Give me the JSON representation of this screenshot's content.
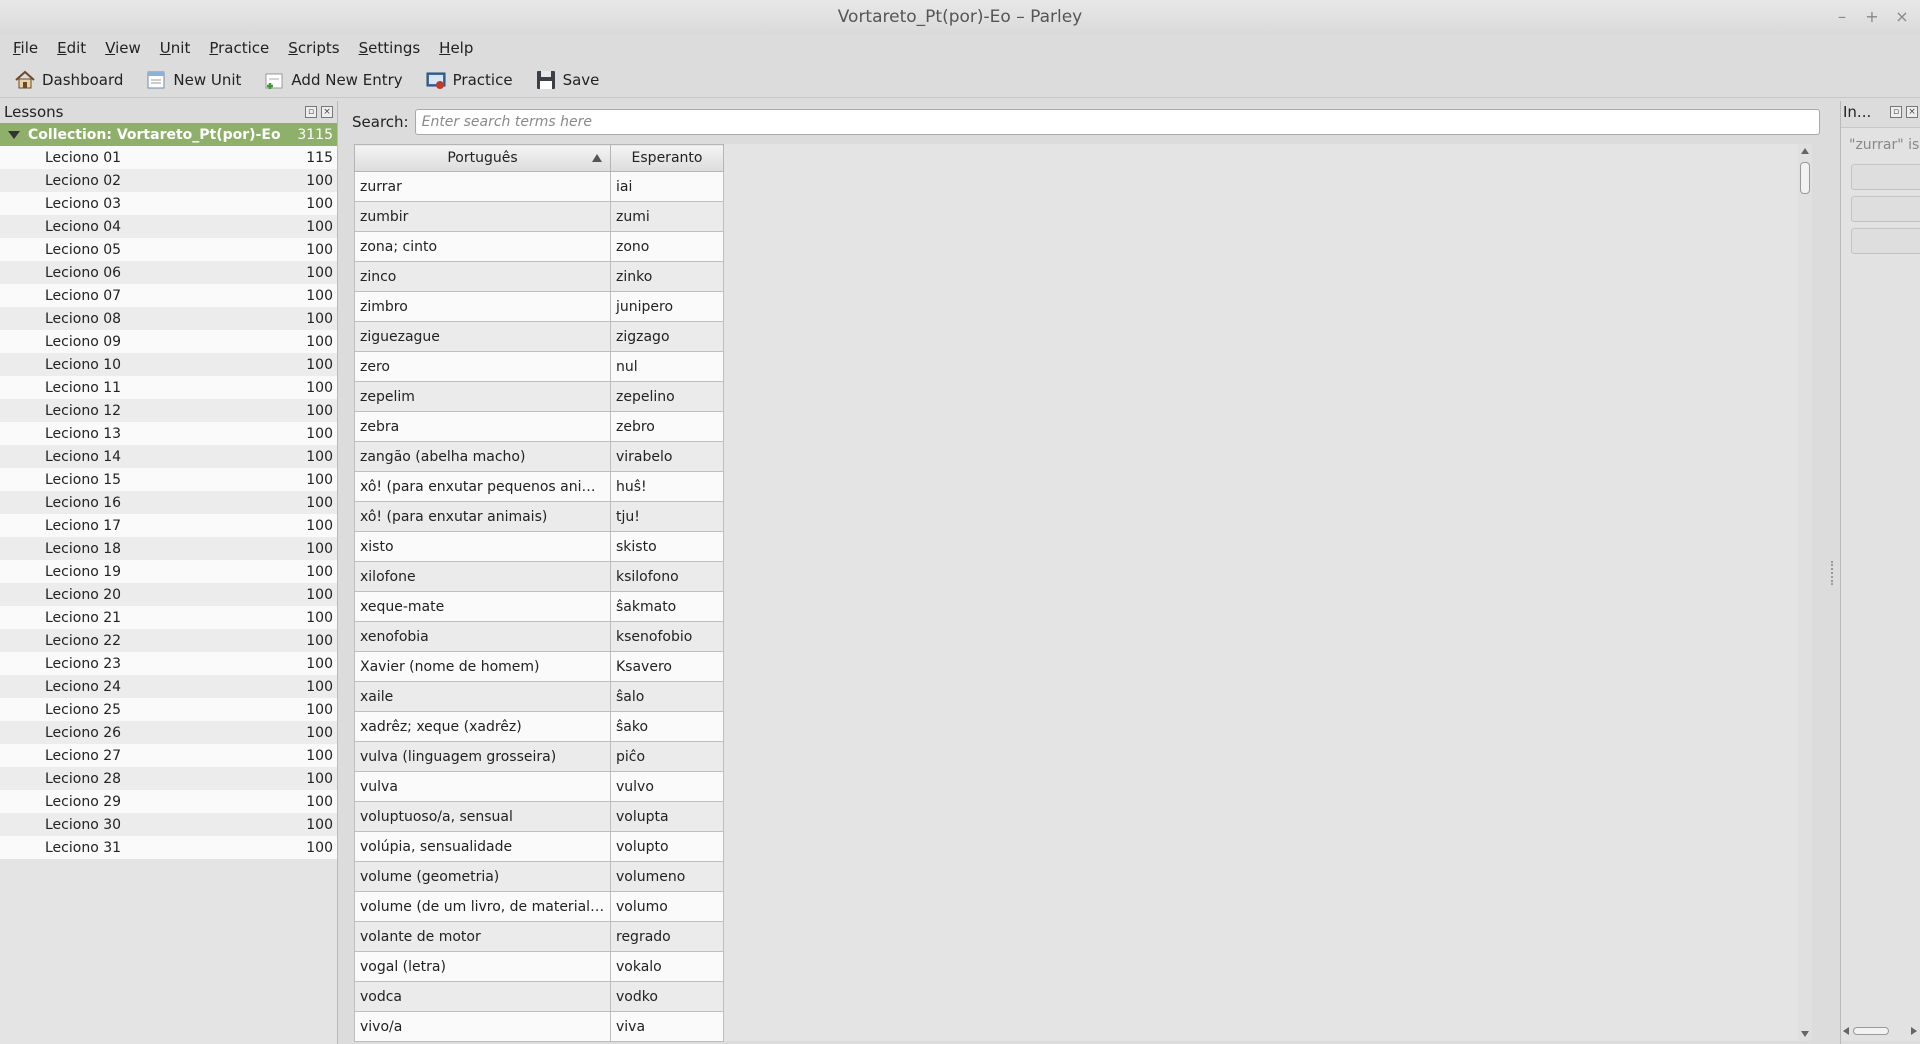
{
  "window": {
    "title": "Vortareto_Pt(por)-Eo – Parley",
    "controls": [
      "–",
      "+",
      "×"
    ]
  },
  "menubar": [
    {
      "acc": "F",
      "rest": "ile"
    },
    {
      "acc": "E",
      "rest": "dit"
    },
    {
      "acc": "V",
      "rest": "iew"
    },
    {
      "acc": "U",
      "rest": "nit"
    },
    {
      "acc": "P",
      "rest": "ractice"
    },
    {
      "acc": "S",
      "rest": "cripts"
    },
    {
      "acc": "S",
      "rest": "ettings"
    },
    {
      "acc": "H",
      "rest": "elp"
    }
  ],
  "toolbar": {
    "dashboard": "Dashboard",
    "new_unit": "New Unit",
    "add_entry": "Add New Entry",
    "practice": "Practice",
    "save": "Save"
  },
  "lessons": {
    "header": "Lessons",
    "collection": {
      "name": "Collection: Vortareto_Pt(por)-Eo",
      "count": "3115"
    },
    "items": [
      {
        "name": "Leciono 01",
        "count": "115"
      },
      {
        "name": "Leciono 02",
        "count": "100"
      },
      {
        "name": "Leciono 03",
        "count": "100"
      },
      {
        "name": "Leciono 04",
        "count": "100"
      },
      {
        "name": "Leciono 05",
        "count": "100"
      },
      {
        "name": "Leciono 06",
        "count": "100"
      },
      {
        "name": "Leciono 07",
        "count": "100"
      },
      {
        "name": "Leciono 08",
        "count": "100"
      },
      {
        "name": "Leciono 09",
        "count": "100"
      },
      {
        "name": "Leciono 10",
        "count": "100"
      },
      {
        "name": "Leciono 11",
        "count": "100"
      },
      {
        "name": "Leciono 12",
        "count": "100"
      },
      {
        "name": "Leciono 13",
        "count": "100"
      },
      {
        "name": "Leciono 14",
        "count": "100"
      },
      {
        "name": "Leciono 15",
        "count": "100"
      },
      {
        "name": "Leciono 16",
        "count": "100"
      },
      {
        "name": "Leciono 17",
        "count": "100"
      },
      {
        "name": "Leciono 18",
        "count": "100"
      },
      {
        "name": "Leciono 19",
        "count": "100"
      },
      {
        "name": "Leciono 20",
        "count": "100"
      },
      {
        "name": "Leciono 21",
        "count": "100"
      },
      {
        "name": "Leciono 22",
        "count": "100"
      },
      {
        "name": "Leciono 23",
        "count": "100"
      },
      {
        "name": "Leciono 24",
        "count": "100"
      },
      {
        "name": "Leciono 25",
        "count": "100"
      },
      {
        "name": "Leciono 26",
        "count": "100"
      },
      {
        "name": "Leciono 27",
        "count": "100"
      },
      {
        "name": "Leciono 28",
        "count": "100"
      },
      {
        "name": "Leciono 29",
        "count": "100"
      },
      {
        "name": "Leciono 30",
        "count": "100"
      },
      {
        "name": "Leciono 31",
        "count": "100"
      }
    ]
  },
  "search": {
    "label": "Search:",
    "placeholder": "Enter search terms here",
    "value": ""
  },
  "table": {
    "columns": [
      "Português",
      "Esperanto"
    ],
    "sort_column": "Português",
    "rows": [
      [
        "zurrar",
        "iai"
      ],
      [
        "zumbir",
        "zumi"
      ],
      [
        "zona; cinto",
        "zono"
      ],
      [
        "zinco",
        "zinko"
      ],
      [
        "zimbro",
        "junipero"
      ],
      [
        "ziguezague",
        "zigzago"
      ],
      [
        "zero",
        "nul"
      ],
      [
        "zepelim",
        "zepelino"
      ],
      [
        "zebra",
        "zebro"
      ],
      [
        "zangão (abelha macho)",
        "virabelo"
      ],
      [
        "xô! (para enxutar pequenos animais)",
        "huŝ!"
      ],
      [
        "xô! (para enxutar animais)",
        "tju!"
      ],
      [
        "xisto",
        "skisto"
      ],
      [
        "xilofone",
        "ksilofono"
      ],
      [
        "xeque-mate",
        "ŝakmato"
      ],
      [
        "xenofobia",
        "ksenofobio"
      ],
      [
        "Xavier (nome de homem)",
        "Ksavero"
      ],
      [
        "xaile",
        "ŝalo"
      ],
      [
        "xadrêz; xeque (xadrêz)",
        "ŝako"
      ],
      [
        "vulva (linguagem grosseira)",
        "piĉo"
      ],
      [
        "vulva",
        "vulvo"
      ],
      [
        "voluptuoso/a, sensual",
        "volupta"
      ],
      [
        "volúpia, sensualidade",
        "volupto"
      ],
      [
        "volume (geometria)",
        "volumeno"
      ],
      [
        "volume (de um livro, de material escrito)",
        "volumo"
      ],
      [
        "volante de motor",
        "regrado"
      ],
      [
        "vogal (letra)",
        "vokalo"
      ],
      [
        "vodca",
        "vodko"
      ],
      [
        "vivo/a",
        "viva"
      ]
    ]
  },
  "info_panel": {
    "header": "In...",
    "text": "\"zurrar\" is"
  }
}
